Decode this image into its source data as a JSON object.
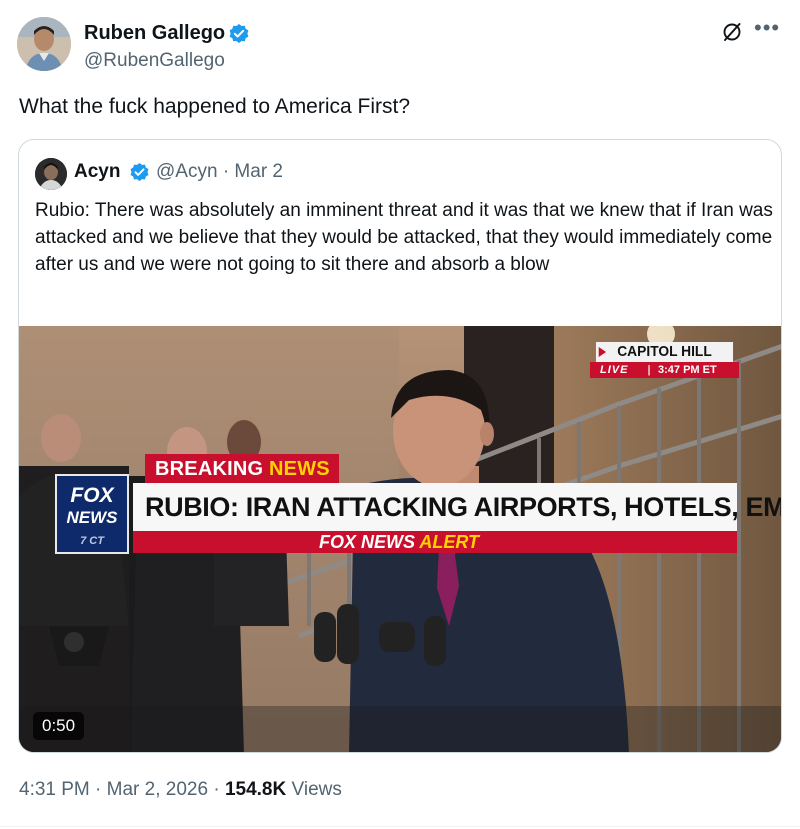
{
  "author": {
    "name": "Ruben Gallego",
    "handle": "@RubenGallego",
    "verified": true,
    "verified_color": "#1d9bf0"
  },
  "tweet": {
    "text": "What the fuck happened to America First?"
  },
  "quoted": {
    "name": "Acyn",
    "handle": "@Acyn",
    "separator": "·",
    "date": "Mar 2",
    "verified": true,
    "text": "Rubio: There was absolutely an imminent threat and it was that we knew that if Iran was attacked and we believe that they would be attacked, that they would immediately come after us and we were not going to sit there and absorb a blow",
    "video": {
      "duration": "0:50",
      "chyron": {
        "location": "CAPITOL HILL",
        "live": "LIVE",
        "live_sep": "|",
        "time": "3:47 PM ET",
        "breaking_1": "BREAKING ",
        "breaking_2": "NEWS",
        "headline": "RUBIO: IRAN ATTACKING AIRPORTS, HOTELS, EMBASSIES",
        "alert_1": "FOX NEWS ",
        "alert_2": "ALERT",
        "logo_1": "FOX",
        "logo_2": "NEWS",
        "logo_3": "7 CT"
      }
    }
  },
  "footer": {
    "time": "4:31 PM",
    "sep": " · ",
    "date": "Mar 2, 2026",
    "views": "154.8K",
    "views_label": " Views"
  },
  "icons": {
    "grok": "grok-icon",
    "more": "more-icon"
  },
  "colors": {
    "text": "#0f1419",
    "secondary": "#536471",
    "border": "#cfd9de",
    "fox_red": "#c8102e",
    "fox_yellow": "#ffd200",
    "fox_blue": "#0f2a6b"
  }
}
